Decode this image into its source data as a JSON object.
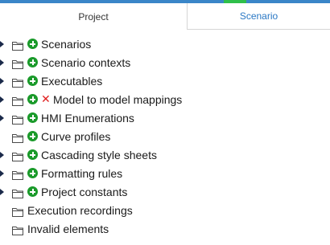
{
  "tabs": {
    "project": "Project",
    "scenario": "Scenario"
  },
  "tree": {
    "items": [
      {
        "label": "Scenarios",
        "expandable": true,
        "add": true,
        "remove": false
      },
      {
        "label": "Scenario contexts",
        "expandable": true,
        "add": true,
        "remove": false
      },
      {
        "label": "Executables",
        "expandable": true,
        "add": true,
        "remove": false
      },
      {
        "label": "Model to model mappings",
        "expandable": true,
        "add": true,
        "remove": true
      },
      {
        "label": "HMI Enumerations",
        "expandable": true,
        "add": true,
        "remove": false
      },
      {
        "label": "Curve profiles",
        "expandable": false,
        "add": true,
        "remove": false
      },
      {
        "label": "Cascading style sheets",
        "expandable": true,
        "add": true,
        "remove": false
      },
      {
        "label": "Formatting rules",
        "expandable": true,
        "add": true,
        "remove": false
      },
      {
        "label": "Project constants",
        "expandable": true,
        "add": true,
        "remove": false
      },
      {
        "label": "Execution recordings",
        "expandable": false,
        "add": false,
        "remove": false
      },
      {
        "label": "Invalid elements",
        "expandable": false,
        "add": false,
        "remove": false
      }
    ]
  },
  "colors": {
    "accent_blue": "#3a86c8",
    "accent_green": "#2fbf4a",
    "add_icon": "#1a9a2a",
    "remove_icon": "#e02020",
    "tab_active_text": "#333333",
    "tab_inactive_text": "#2a78c4"
  }
}
